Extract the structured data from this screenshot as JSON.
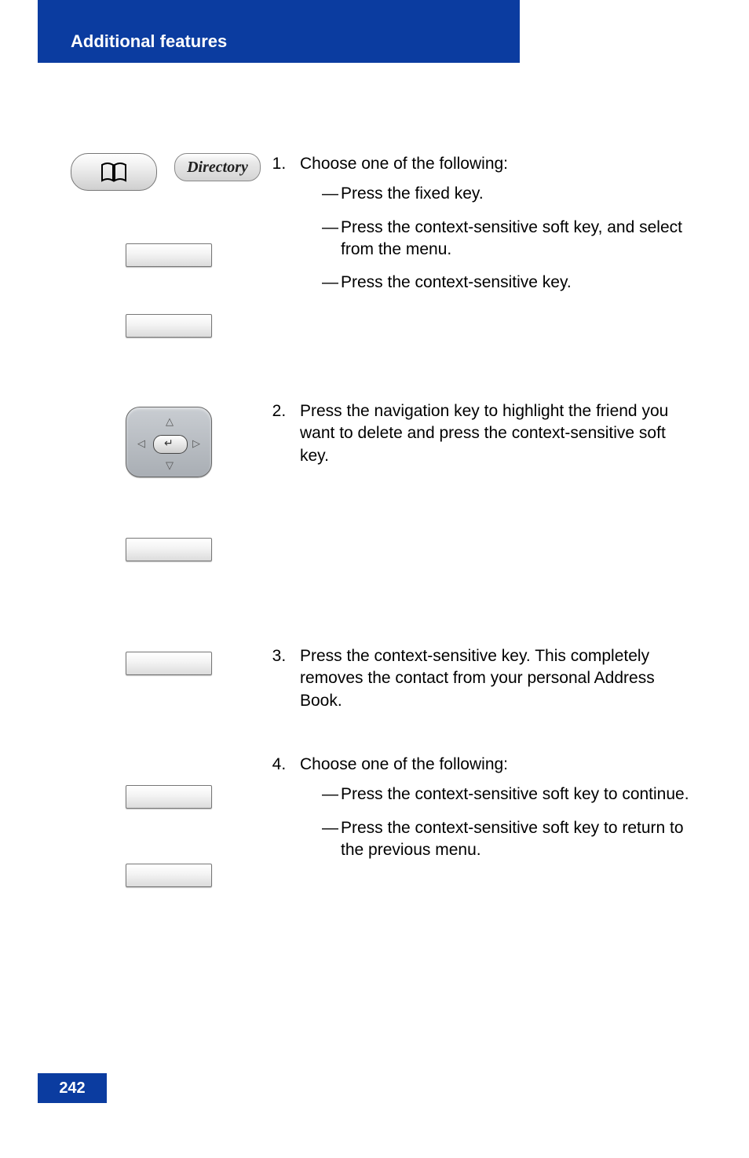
{
  "header": {
    "title": "Additional features"
  },
  "directory_label": "Directory",
  "steps": {
    "s1": {
      "intro": "Choose one of the following:",
      "a": {
        "t1": "Press the ",
        "t2": " fixed key."
      },
      "b": {
        "t1": "Press the ",
        "t2": " context-sensitive soft key, and select ",
        "t3": " from the menu."
      },
      "c": {
        "t1": "Press the ",
        "t2": " context-sensitive key."
      }
    },
    "s2": {
      "t1": "Press the ",
      "t2": " navigation key to highlight the friend you want to delete and press the ",
      "t3": " context-sensitive soft key."
    },
    "s3": {
      "t1": "Press the ",
      "t2": " context-sensitive key. This completely removes the contact from your personal Address Book."
    },
    "s4": {
      "intro": "Choose one of the following:",
      "a": {
        "t1": "Press the ",
        "t2": " context-sensitive soft key to continue."
      },
      "b": {
        "t1": "Press the ",
        "t2": " context-sensitive soft key to return to the previous menu."
      }
    }
  },
  "page_number": "242"
}
